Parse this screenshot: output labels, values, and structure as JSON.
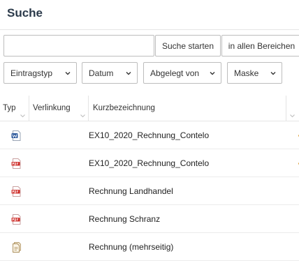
{
  "page": {
    "title": "Suche"
  },
  "search": {
    "value": "",
    "placeholder": "",
    "start_label": "Suche starten",
    "scope_label": "in allen Bereichen"
  },
  "filters": [
    {
      "label": "Eintragstyp"
    },
    {
      "label": "Datum"
    },
    {
      "label": "Abgelegt von"
    },
    {
      "label": "Maske"
    }
  ],
  "table": {
    "columns": [
      {
        "label": "Typ"
      },
      {
        "label": "Verlinkung"
      },
      {
        "label": "Kurzbezeichnung"
      }
    ],
    "rows": [
      {
        "icon": "word-document-icon",
        "name": "EX10_2020_Rechnung_Contelo"
      },
      {
        "icon": "pdf-icon",
        "name": "EX10_2020_Rechnung_Contelo"
      },
      {
        "icon": "pdf-icon",
        "name": "Rechnung Landhandel"
      },
      {
        "icon": "pdf-icon",
        "name": "Rechnung Schranz"
      },
      {
        "icon": "multi-page-document-icon",
        "name": "Rechnung (mehrseitig)"
      }
    ]
  },
  "colors": {
    "title": "#2b3a4a",
    "border": "#bdbdbd",
    "word_blue": "#2b579a",
    "pdf_red": "#d0312d",
    "accent_dot": "#e0a23c"
  }
}
